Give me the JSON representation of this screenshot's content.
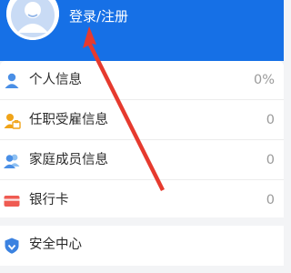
{
  "header": {
    "login_label": "登录/注册",
    "bg_color": "#1670e6"
  },
  "info_items": [
    {
      "icon": "person-icon",
      "label": "个人信息",
      "value": "0%"
    },
    {
      "icon": "employment-icon",
      "label": "任职受雇信息",
      "value": "0"
    },
    {
      "icon": "family-icon",
      "label": "家庭成员信息",
      "value": "0"
    },
    {
      "icon": "bank-card-icon",
      "label": "银行卡",
      "value": "0"
    }
  ],
  "security": {
    "icon": "shield-icon",
    "label": "安全中心"
  },
  "annotation": {
    "color": "#e63a2e"
  }
}
